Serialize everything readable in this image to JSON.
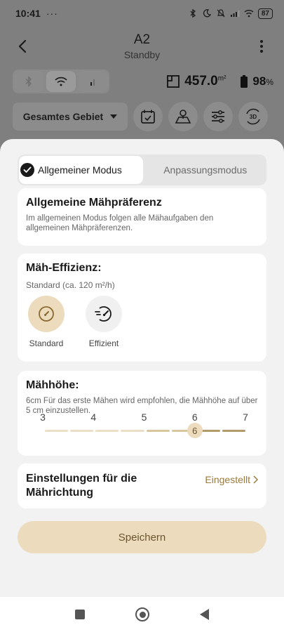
{
  "status_bar": {
    "time": "10:41",
    "dots": "···",
    "battery": "87"
  },
  "header": {
    "title": "A2",
    "status": "Standby"
  },
  "stats": {
    "area_value": "457.0",
    "area_unit": "m²",
    "battery_value": "98",
    "battery_unit": "%"
  },
  "toolbar": {
    "area_select_label": "Gesamtes Gebiet",
    "view_3d_label": "3D"
  },
  "modes": {
    "tab_general": "Allgemeiner Modus",
    "tab_custom": "Anpassungsmodus",
    "active": "tab_general"
  },
  "preference_card": {
    "title": "Allgemeine Mähpräferenz",
    "description": "Im allgemeinen Modus folgen alle Mähaufgaben den allgemeinen Mähpräferenzen."
  },
  "efficiency_card": {
    "title": "Mäh-Effizienz:",
    "subtitle": "Standard (ca. 120 m²/h)",
    "options": [
      {
        "label": "Standard",
        "icon": "compass-icon",
        "selected": true
      },
      {
        "label": "Effizient",
        "icon": "speed-icon",
        "selected": false
      }
    ]
  },
  "height_card": {
    "title": "Mähhöhe:",
    "description": "6cm Für das erste Mähen wird empfohlen, die Mähhöhe auf über 5 cm einzustellen.",
    "ticks": [
      "3",
      "4",
      "5",
      "6",
      "7"
    ],
    "current_value": "6",
    "current_index": 3
  },
  "direction_card": {
    "title": "Einstellungen für die Mährichtung",
    "link_label": "Eingestellt"
  },
  "save_button": "Speichern",
  "colors": {
    "accent_bg": "#ecdcbd",
    "accent_text": "#6b5530",
    "link": "#9a7a3c",
    "overlay": "#7f7f7f"
  }
}
